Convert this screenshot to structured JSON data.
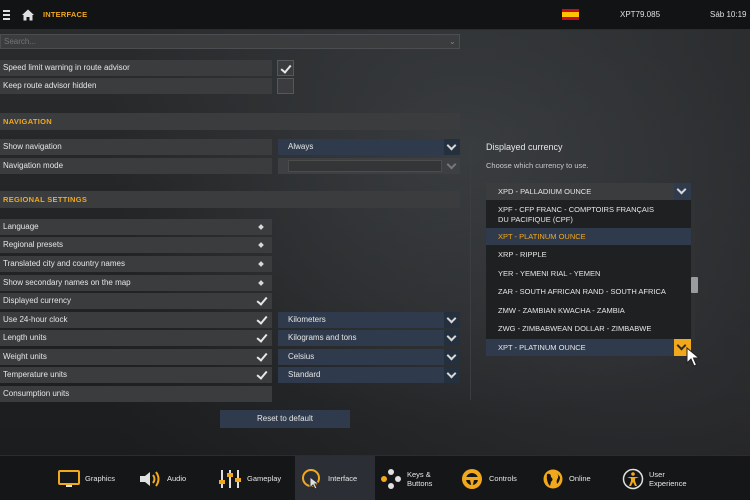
{
  "topbar": {
    "breadcrumb": "INTERFACE",
    "money": "XPT79.085",
    "clock": "Sáb 10:19"
  },
  "search": {
    "placeholder": "Search..."
  },
  "advisor": {
    "speed_limit_label": "Speed limit warning in route advisor",
    "speed_limit_checked": true,
    "keep_hidden_label": "Keep route advisor hidden",
    "keep_hidden_checked": false
  },
  "navigation": {
    "header": "NAVIGATION",
    "show_label": "Show navigation",
    "show_value": "Always",
    "mode_label": "Navigation mode"
  },
  "regional": {
    "header": "REGIONAL SETTINGS",
    "language": "Language",
    "presets": "Regional presets",
    "translated": "Translated city and country names",
    "secondary": "Show secondary names on the map",
    "currency": "Displayed currency",
    "clock24": "Use 24-hour clock",
    "length": "Length units",
    "length_value": "Kilometers",
    "weight": "Weight units",
    "weight_value": "Kilograms and tons",
    "temperature": "Temperature units",
    "temperature_value": "Celsius",
    "consumption": "Consumption units",
    "consumption_value": "Standard"
  },
  "reset_label": "Reset to default",
  "currency_panel": {
    "title": "Displayed currency",
    "subtitle": "Choose which currency to use.",
    "head": "XPD - PALLADIUM OUNCE",
    "items": [
      "XPF - CFP FRANC - COMPTOIRS FRANÇAIS",
      "DU PACIFIQUE (CPF)",
      "XPT - PLATINUM OUNCE",
      "XRP - RIPPLE",
      "YER - YEMENI RIAL - YEMEN",
      "ZAR - SOUTH AFRICAN RAND - SOUTH AFRICA",
      "ZMW - ZAMBIAN KWACHA - ZAMBIA",
      "ZWG - ZIMBABWEAN DOLLAR - ZIMBABWE"
    ],
    "selected": "XPT - PLATINUM OUNCE"
  },
  "bottom_tabs": {
    "graphics": "Graphics",
    "audio": "Audio",
    "gameplay": "Gameplay",
    "interface": "Interface",
    "keys_1": "Keys &",
    "keys_2": "Buttons",
    "controls": "Controls",
    "online": "Online",
    "user_1": "User",
    "user_2": "Experience"
  },
  "colors": {
    "accent": "#f2a81d",
    "select_bg": "#2f3b4c",
    "row_bg": "#3a3c3e"
  }
}
